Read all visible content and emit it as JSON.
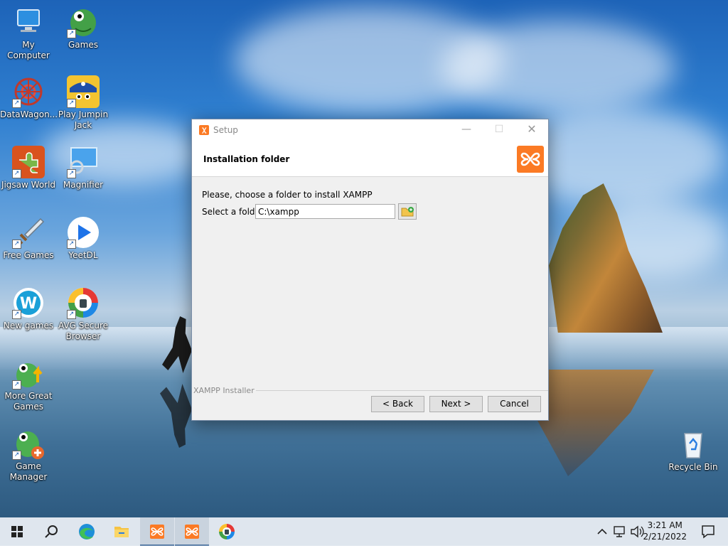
{
  "desktop": {
    "icons": [
      {
        "label": "My Computer"
      },
      {
        "label": "Games"
      },
      {
        "label": "DataWagon..."
      },
      {
        "label": "Play Jumpin Jack"
      },
      {
        "label": "Jigsaw World"
      },
      {
        "label": "Magnifier"
      },
      {
        "label": "Free Games"
      },
      {
        "label": "YeetDL"
      },
      {
        "label": "New games"
      },
      {
        "label": "AVG Secure Browser"
      },
      {
        "label": "More Great Games"
      },
      {
        "label": "Game Manager"
      },
      {
        "label": "Recycle Bin"
      }
    ]
  },
  "window": {
    "title": "Setup",
    "header_title": "Installation folder",
    "prompt": "Please, choose a folder to install XAMPP",
    "folder_label": "Select a folder",
    "folder_value": "C:\\xampp",
    "footer_label": "XAMPP Installer",
    "back_label": "< Back",
    "next_label": "Next >",
    "cancel_label": "Cancel",
    "accent_color": "#fb7a24"
  },
  "taskbar": {
    "items": [
      "start-icon",
      "search-icon",
      "edge-icon",
      "file-explorer-icon",
      "xampp-icon",
      "xampp-setup-icon",
      "avg-browser-icon"
    ],
    "clock_time": "3:21 AM",
    "clock_date": "2/21/2022"
  }
}
